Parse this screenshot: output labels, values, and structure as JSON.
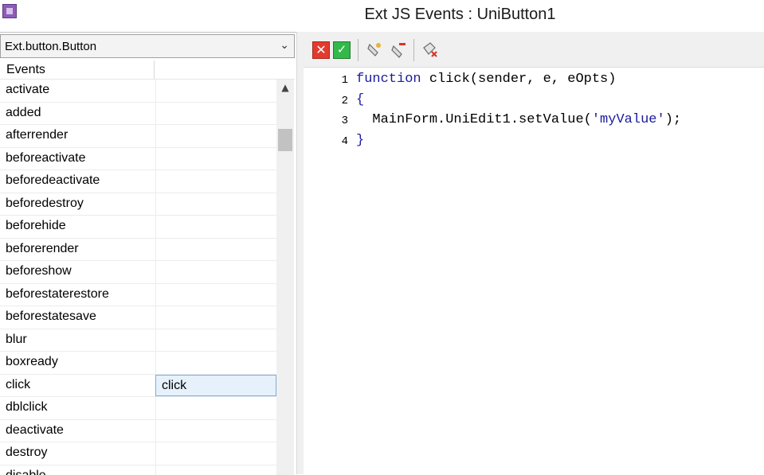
{
  "window": {
    "title": "Ext JS Events : UniButton1",
    "icon": "app-icon"
  },
  "left": {
    "class_selector": {
      "value": "Ext.button.Button",
      "arrow": "⌄"
    },
    "grid": {
      "header_events": "Events",
      "rows": [
        {
          "name": "activate",
          "value": ""
        },
        {
          "name": "added",
          "value": ""
        },
        {
          "name": "afterrender",
          "value": ""
        },
        {
          "name": "beforeactivate",
          "value": ""
        },
        {
          "name": "beforedeactivate",
          "value": ""
        },
        {
          "name": "beforedestroy",
          "value": ""
        },
        {
          "name": "beforehide",
          "value": ""
        },
        {
          "name": "beforerender",
          "value": ""
        },
        {
          "name": "beforeshow",
          "value": ""
        },
        {
          "name": "beforestaterestore",
          "value": ""
        },
        {
          "name": "beforestatesave",
          "value": ""
        },
        {
          "name": "blur",
          "value": ""
        },
        {
          "name": "boxready",
          "value": ""
        },
        {
          "name": "click",
          "value": "click"
        },
        {
          "name": "dblclick",
          "value": ""
        },
        {
          "name": "deactivate",
          "value": ""
        },
        {
          "name": "destroy",
          "value": ""
        },
        {
          "name": "disable",
          "value": ""
        }
      ]
    }
  },
  "toolbar": {
    "cancel_label": "✕",
    "ok_label": "✓",
    "icons": [
      "cancel-icon",
      "ok-icon",
      "clear-event-icon",
      "remove-event-icon",
      "erase-all-icon"
    ]
  },
  "editor": {
    "lines": [
      {
        "num": "1",
        "code": "function click(sender, e, eOpts)"
      },
      {
        "num": "2",
        "code": "{"
      },
      {
        "num": "3",
        "code": "  MainForm.UniEdit1.setValue('myValue');"
      },
      {
        "num": "4",
        "code": "}"
      }
    ]
  }
}
